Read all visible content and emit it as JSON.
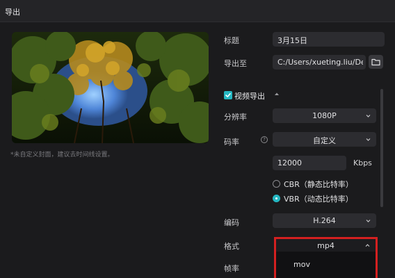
{
  "window": {
    "title": "导出"
  },
  "preview": {
    "hint": "*未自定义封面，建议去时间线设置。"
  },
  "form": {
    "title_label": "标题",
    "title_value": "3月15日",
    "export_to_label": "导出至",
    "export_path": "C:/Users/xueting.liu/De...",
    "video_export_label": "视频导出",
    "resolution_label": "分辨率",
    "resolution_value": "1080P",
    "bitrate_label": "码率",
    "bitrate_value": "自定义",
    "bitrate_number": "12000",
    "bitrate_unit": "Kbps",
    "cbr_label": "CBR（静态比特率）",
    "vbr_label": "VBR（动态比特率）",
    "codec_label": "编码",
    "codec_value": "H.264",
    "format_label": "格式",
    "format_value": "mp4",
    "format_option": "mov",
    "framerate_label": "帧率",
    "help_glyph": "?"
  },
  "colors": {
    "accent": "#25b7c2",
    "highlight_border": "#d42020"
  },
  "icons": [
    "folder-icon",
    "checkbox-checked-icon",
    "chevron-up-icon",
    "chevron-down-icon",
    "help-icon"
  ]
}
